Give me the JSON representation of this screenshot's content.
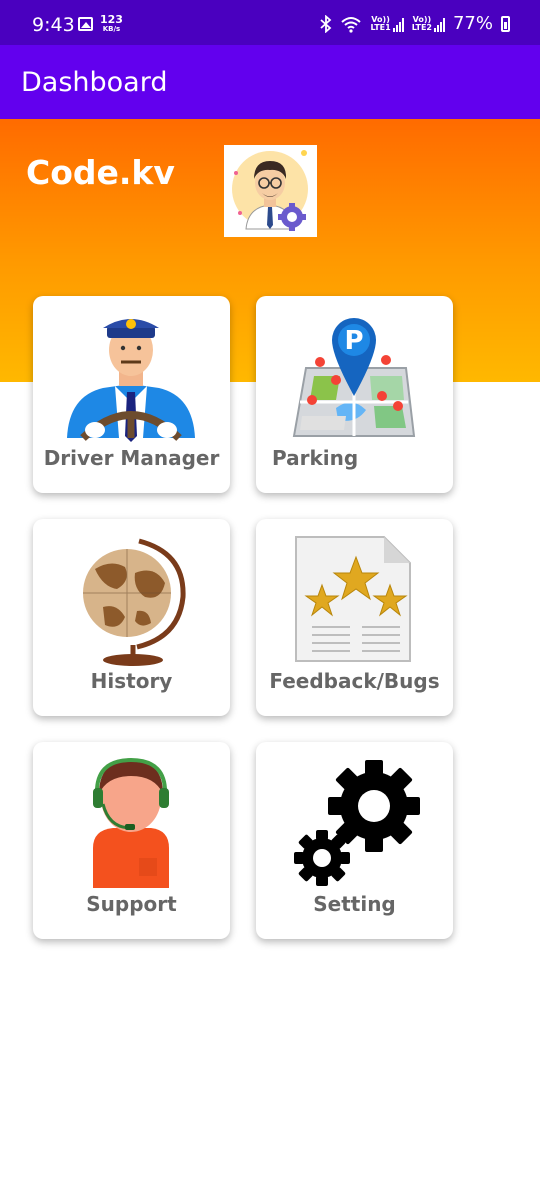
{
  "status_bar": {
    "time": "9:43",
    "speed_value": "123",
    "speed_unit": "KB/s",
    "sim1_label_top": "Vo))",
    "sim1_label_bottom": "LTE1",
    "sim2_label_top": "Vo))",
    "sim2_label_bottom": "LTE2",
    "battery": "77%"
  },
  "app_bar": {
    "title": "Dashboard"
  },
  "header": {
    "user_name": "Code.kv"
  },
  "cards": [
    {
      "label": "Driver Manager",
      "icon": "driver-icon"
    },
    {
      "label": "Parking",
      "icon": "parking-map-icon"
    },
    {
      "label": "History",
      "icon": "globe-icon"
    },
    {
      "label": "Feedback/Bugs",
      "icon": "star-rating-document-icon"
    },
    {
      "label": "Support",
      "icon": "support-agent-icon"
    },
    {
      "label": "Setting",
      "icon": "gears-icon"
    }
  ],
  "colors": {
    "status_bar": "#4A00BF",
    "app_bar": "#6200EE",
    "hero_top": "#FF6B00",
    "hero_bottom": "#FFB800",
    "card_label": "#666666"
  }
}
